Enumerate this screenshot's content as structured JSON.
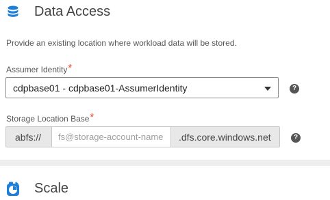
{
  "data_access": {
    "title": "Data Access",
    "icon": "database-icon",
    "description": "Provide an existing location where workload data will be stored."
  },
  "assumer_identity": {
    "label": "Assumer Identity",
    "required_mark": "*",
    "value": "cdpbase01 - cdpbase01-AssumerIdentity",
    "help": "?"
  },
  "storage_location": {
    "label": "Storage Location Base",
    "required_mark": "*",
    "prefix": "abfs://",
    "placeholder": "fs@storage-account-name",
    "value": "",
    "suffix": ".dfs.core.windows.net",
    "help": "?"
  },
  "scale": {
    "title": "Scale",
    "icon": "gauge-icon"
  },
  "colors": {
    "accent": "#1d7fd8",
    "required": "#e8422b",
    "addon_bg": "#e8e8e8",
    "divider": "#eeeeee"
  }
}
